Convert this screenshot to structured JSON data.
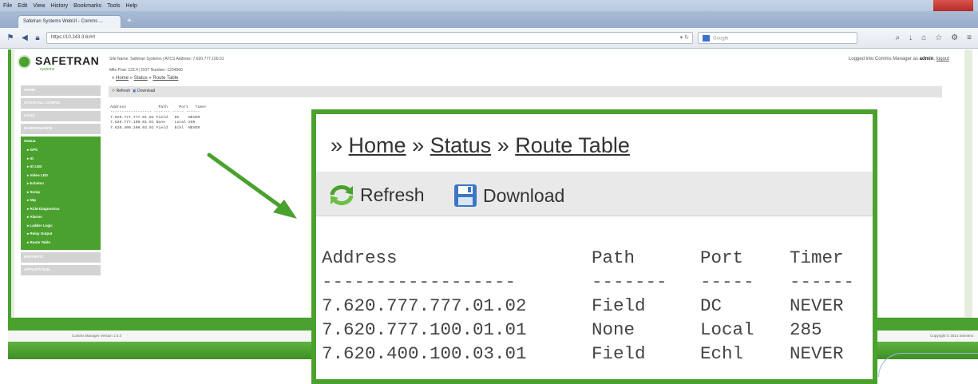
{
  "browser": {
    "menu": [
      "File",
      "Edit",
      "View",
      "History",
      "Bookmarks",
      "Tools",
      "Help"
    ],
    "tab_title": "Safetran Systems WebUI - Comms ...",
    "new_tab": "+",
    "url": "https://10.243.3.6/#rt",
    "search_placeholder": "Google"
  },
  "header": {
    "logo": "SAFETRAN",
    "logo_sub": "systems",
    "site_info": "Site Name: Safetran Systems  |  ATCS Address: 7.620.777.100.01",
    "milepost": "Mile Post:  123.4          |  DOT Number:  1234560",
    "logged_prefix": "Logged into Comms Manager as ",
    "logged_user": "admin",
    "logout": "logout"
  },
  "breadcrumb": {
    "sep": "»",
    "home": "Home",
    "status": "Status",
    "route_table": "Route Table"
  },
  "toolbar": {
    "refresh": "Refresh",
    "download": "Download"
  },
  "sidebar": {
    "items_top": [
      "Home",
      "Site/Still Config",
      "Logs",
      "Maintenance"
    ],
    "status_header": "Status",
    "status_sub": [
      "GPS",
      "IO",
      "IO LED",
      "Video LED",
      "Echelon",
      "Snmp",
      "Ntp",
      "RCM Diagnostics",
      "Alarms",
      "Ladder Logic",
      "Relay Output",
      "Route Table"
    ],
    "items_bottom": [
      "Reports",
      "Application"
    ]
  },
  "route_table": {
    "headers": [
      "Address",
      "Path",
      "Port",
      "Timer"
    ],
    "separators": [
      "------------------",
      "-------",
      "-----",
      "------"
    ],
    "rows": [
      [
        "7.620.777.777.01.02",
        "Field",
        "DC",
        "NEVER"
      ],
      [
        "7.620.777.100.01.01",
        "None",
        "Local",
        "285"
      ],
      [
        "7.620.400.100.03.01",
        "Field",
        "Echl",
        "NEVER"
      ]
    ]
  },
  "footer": {
    "version": "Comms Manager Version 1.0.3",
    "copyright": "Copyright © 2014 Siemens"
  },
  "colors": {
    "accent": "#4aa12e",
    "link": "#333333",
    "download_icon": "#3b77c4"
  }
}
